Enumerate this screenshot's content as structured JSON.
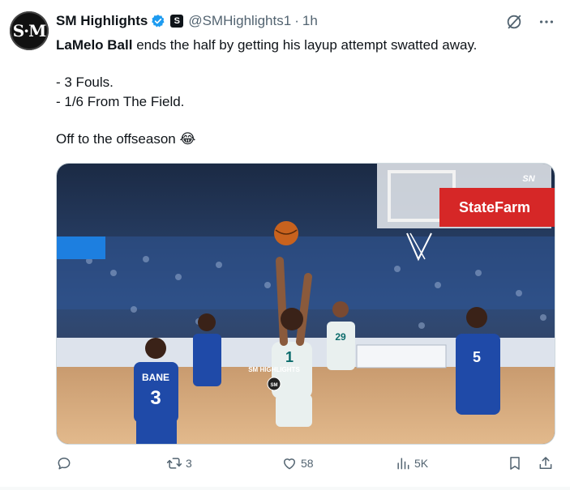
{
  "tweet": {
    "display_name": "SM Highlights",
    "handle": "@SMHighlights1",
    "separator": "·",
    "time": "1h",
    "avatar_text": "S·M",
    "body": {
      "line1_bold": "LaMelo Ball",
      "line1_rest": " ends the half by getting his layup attempt swatted away.",
      "line2": "- 3 Fouls.",
      "line3": "- 1/6 From The Field.",
      "line4_text": "Off to the offseason ",
      "line4_emoji": "😂"
    },
    "media": {
      "watermark": "SM HIGHLIGHTS",
      "watermark_logo": "SM",
      "broadcast_bug": "SN",
      "sponsor": "StateFarm",
      "jersey_front": "3",
      "jersey_name": "BANE",
      "jersey_white": "1",
      "jersey_right": "5",
      "jersey_back": "29"
    },
    "stats": {
      "reply_count": "",
      "retweet_count": "3",
      "like_count": "58",
      "views_count": "5K"
    },
    "colors": {
      "accent": "#1d9bf0",
      "muted": "#536471",
      "text": "#0f1419"
    }
  }
}
